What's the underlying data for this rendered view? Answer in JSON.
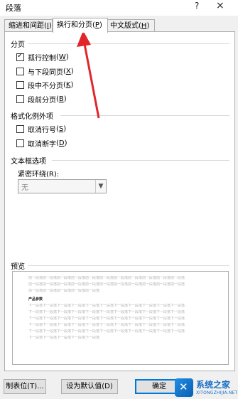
{
  "dialog": {
    "title": "段落",
    "help": "?",
    "close": "×"
  },
  "tabs": [
    {
      "label": "缩进和间距",
      "key": "I",
      "active": false
    },
    {
      "label": "换行和分页",
      "key": "P",
      "active": true
    },
    {
      "label": "中文版式",
      "key": "H",
      "active": false
    }
  ],
  "pagination": {
    "label": "分页",
    "options": [
      {
        "label": "孤行控制",
        "key": "W",
        "checked": true
      },
      {
        "label": "与下段同页",
        "key": "X",
        "checked": false
      },
      {
        "label": "段中不分页",
        "key": "K",
        "checked": false
      },
      {
        "label": "段前分页",
        "key": "B",
        "checked": false
      }
    ]
  },
  "formatting_exceptions": {
    "label": "格式化例外项",
    "options": [
      {
        "label": "取消行号",
        "key": "S",
        "checked": false
      },
      {
        "label": "取消断字",
        "key": "D",
        "checked": false
      }
    ]
  },
  "textbox_options": {
    "label": "文本框选项",
    "tight_wrap_label": "紧密环绕(R):",
    "tight_wrap_value": "无"
  },
  "preview": {
    "label": "预览",
    "prev_lines": [
      "前一段落前一段落前一段落前一段落前一段落前一段落前一段落前一段落前一段落前一段落前一段落",
      "前一段落前一段落前一段落前一段落前一段落前一段落前一段落前一段落前一段落前一段落前一段落",
      "前一段落前一段落前一段落前一段落前一段落"
    ],
    "sample_heading": "产品参数",
    "next_lines": [
      "下一段落下一段落下一段落下一段落下一段落下一段落下一段落下一段落下一段落下一段落下一段落",
      "下一段落下一段落下一段落下一段落下一段落下一段落下一段落下一段落下一段落下一段落下一段落",
      "下一段落下一段落下一段落下一段落下一段落下一段落下一段落下一段落下一段落下一段落下一段落",
      "下一段落下一段落下一段落下一段落下一段落下一段落下一段落下一段落下一段落下一段落下一段落",
      "下一段落下一段落下一段落下一段落下一段落下一段落下一段落下一段落下一段落下一段落下一段落",
      "下一段落下一段落下一段落下一段落下一段落"
    ]
  },
  "buttons": {
    "tabs": {
      "label": "制表位(T)..."
    },
    "set_default": {
      "label": "设为默认值(D)"
    },
    "ok": {
      "label": "确定"
    }
  },
  "annotation": {
    "arrow_color": "#e0262b"
  },
  "watermark": {
    "brand": "系统之家",
    "url": "XITONGZHIJIA.NET",
    "brand_color": "#1a6fc4"
  }
}
